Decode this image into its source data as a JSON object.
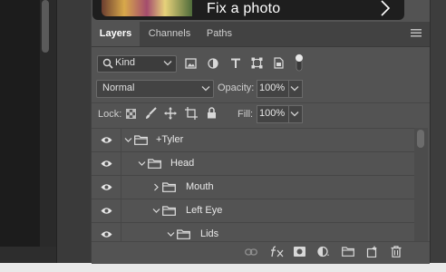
{
  "learn_card": {
    "text": "Fix a photo"
  },
  "tabs": [
    {
      "label": "Layers",
      "active": true
    },
    {
      "label": "Channels",
      "active": false
    },
    {
      "label": "Paths",
      "active": false
    }
  ],
  "filter": {
    "kind_label": "Kind",
    "icons": [
      "image-filter-icon",
      "adjustment-filter-icon",
      "type-filter-icon",
      "shape-filter-icon",
      "smart-object-filter-icon",
      "filter-toggle-icon"
    ]
  },
  "blend": {
    "mode": "Normal",
    "opacity_label": "Opacity:",
    "opacity_value": "100%"
  },
  "lock": {
    "label": "Lock:",
    "icons": [
      "lock-transparent-pixels-icon",
      "lock-image-pixels-icon",
      "lock-position-icon",
      "lock-artboard-icon",
      "lock-all-icon"
    ],
    "fill_label": "Fill:",
    "fill_value": "100%"
  },
  "layers": [
    {
      "name": "+Tyler",
      "visible": true,
      "expanded": true
    },
    {
      "name": "Head",
      "visible": true,
      "expanded": true
    },
    {
      "name": "Mouth",
      "visible": true,
      "expanded": false
    },
    {
      "name": "Left Eye",
      "visible": true,
      "expanded": true
    },
    {
      "name": "Lids",
      "visible": true,
      "expanded": true
    }
  ],
  "footer_icons": [
    "link-layers-icon",
    "fx-icon",
    "add-mask-icon",
    "adjustment-layer-icon",
    "new-group-icon",
    "new-layer-icon",
    "delete-layer-icon"
  ],
  "colors": {
    "panel_bg": "#535353",
    "tab_bar_bg": "#424242",
    "canvas_bg": "#1c1c1c"
  }
}
